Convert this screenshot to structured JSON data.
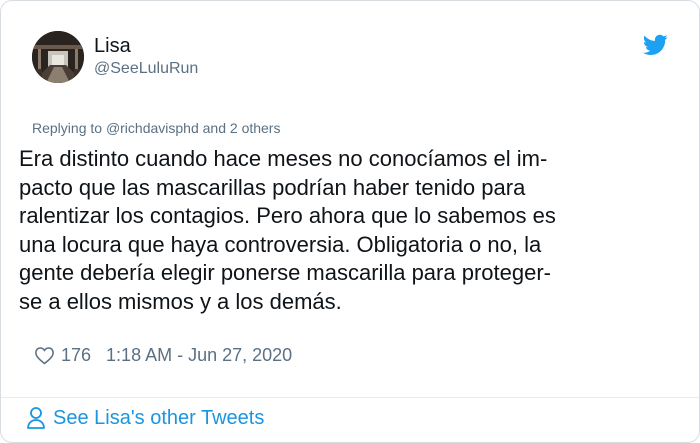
{
  "author": {
    "display_name": "Lisa",
    "handle": "@SeeLuluRun"
  },
  "reply_context": {
    "prefix": "Replying to ",
    "mention": "@richdavisphd",
    "suffix": " and 2 others"
  },
  "tweet": {
    "text": "Era distinto cuando hace meses no conocíamos el im-\npacto que las mascarillas podrían haber tenido para\nralentizar los contagios. Pero ahora que lo sabemos es\nuna locura que haya controversia. Obligatoria o no, la\ngente debería elegir ponerse mascarilla para proteger-\nse a ellos mismos y a los demás.",
    "likes": "176",
    "timestamp": "1:18 AM - Jun 27, 2020"
  },
  "footer": {
    "link_text": "See Lisa's other Tweets"
  },
  "icons": {
    "brand": "twitter-bird-icon",
    "like": "heart-icon",
    "profile": "person-icon"
  },
  "colors": {
    "brand_blue": "#1da1f2",
    "link_blue": "#1b95e0",
    "secondary_text": "#5b7083",
    "primary_text": "#0f1419"
  }
}
